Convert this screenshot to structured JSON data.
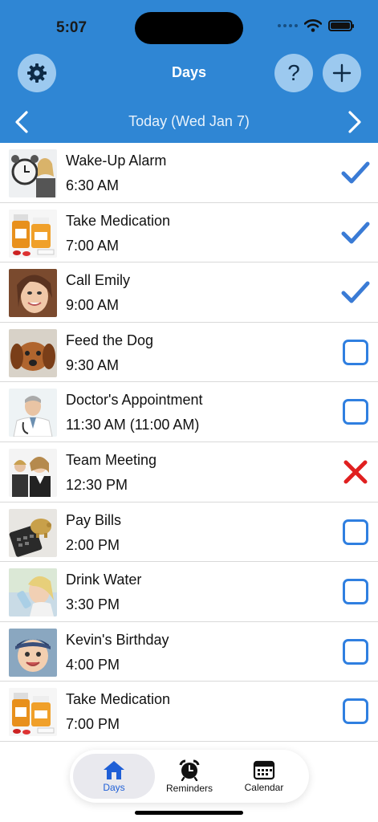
{
  "status_bar": {
    "time": "5:07"
  },
  "header": {
    "title": "Days",
    "date_label": "Today (Wed Jan 7)",
    "help_glyph": "?"
  },
  "colors": {
    "header_bg": "#2f86d4",
    "accent": "#2f7fe0",
    "done_check": "#3a7bd5",
    "missed_x": "#e02020",
    "tab_active": "#1f5fd6"
  },
  "reminders": [
    {
      "title": "Wake-Up Alarm",
      "time": "6:30 AM",
      "status": "done",
      "image": "alarm-clock-woman"
    },
    {
      "title": "Take Medication",
      "time": "7:00 AM",
      "status": "done",
      "image": "pill-bottles"
    },
    {
      "title": "Call Emily",
      "time": "9:00 AM",
      "status": "done",
      "image": "smiling-woman"
    },
    {
      "title": "Feed the Dog",
      "time": "9:30 AM",
      "status": "pending",
      "image": "dog"
    },
    {
      "title": "Doctor's Appointment",
      "time": "11:30 AM (11:00 AM)",
      "status": "pending",
      "image": "doctor"
    },
    {
      "title": "Team Meeting",
      "time": "12:30 PM",
      "status": "missed",
      "image": "business-people"
    },
    {
      "title": "Pay Bills",
      "time": "2:00 PM",
      "status": "pending",
      "image": "piggy-bank-calculator"
    },
    {
      "title": "Drink Water",
      "time": "3:30 PM",
      "status": "pending",
      "image": "woman-drinking-water"
    },
    {
      "title": "Kevin's Birthday",
      "time": "4:00 PM",
      "status": "pending",
      "image": "baby-boy"
    },
    {
      "title": "Take Medication",
      "time": "7:00 PM",
      "status": "pending",
      "image": "pill-bottles"
    }
  ],
  "tabbar": {
    "tabs": [
      {
        "label": "Days",
        "icon": "house-icon",
        "active": true
      },
      {
        "label": "Reminders",
        "icon": "alarm-clock-icon",
        "active": false
      },
      {
        "label": "Calendar",
        "icon": "calendar-icon",
        "active": false
      }
    ]
  }
}
